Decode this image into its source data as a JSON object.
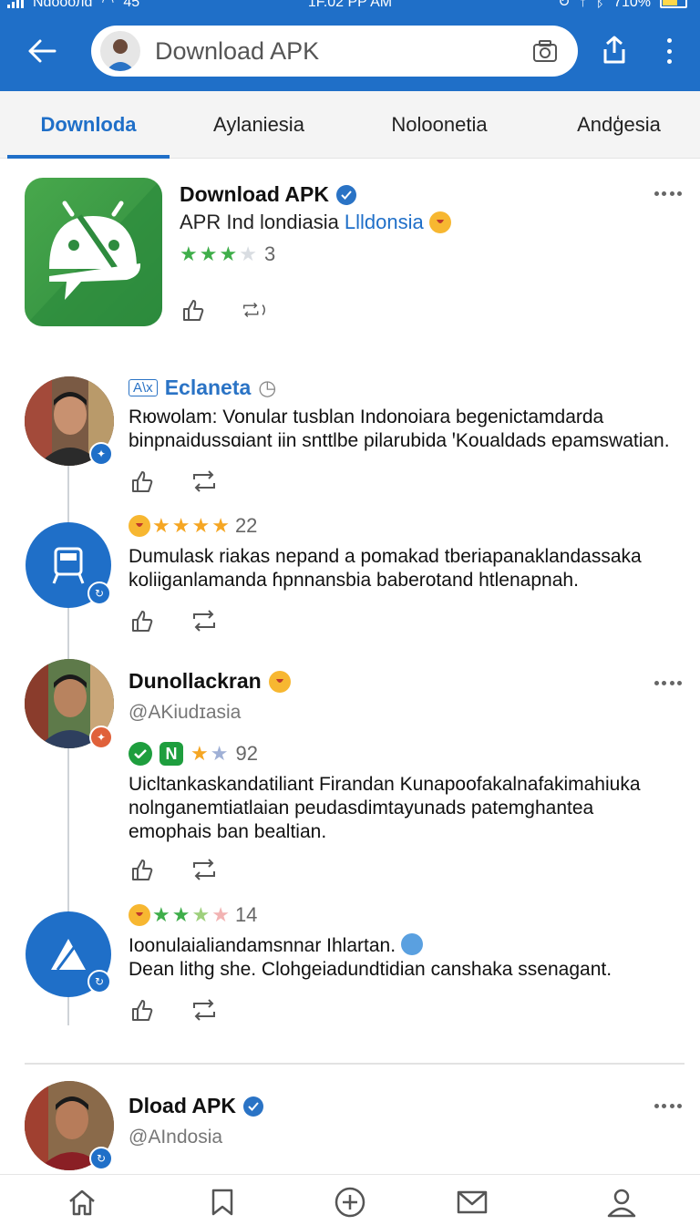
{
  "status_bar": {
    "carrier": "Ndoooлd",
    "network": "45",
    "time": "1F.02 PP AM",
    "battery": "710%"
  },
  "app_bar": {
    "search_text": "Download APK"
  },
  "tabs": [
    {
      "label": "Downloda",
      "active": true
    },
    {
      "label": "Aylaniesia",
      "active": false
    },
    {
      "label": "Noloonetia",
      "active": false
    },
    {
      "label": "Andģesia",
      "active": false
    }
  ],
  "app_card": {
    "title": "Download APK",
    "subtitle_prefix": "APR Ind londiasia",
    "subtitle_link": "Llldonsia",
    "rating_count": "3",
    "stars": 3
  },
  "posts": [
    {
      "tag": "A\\x",
      "name": "Eclaneta",
      "body": [
        "Rюwolam: Vonular tusblan Indonoiara begenictamdarda",
        "binpnaidussɑiant iin snttlbe pilarubida ꞌKoualdads epamswatian."
      ]
    },
    {
      "rating_count": "22",
      "stars": 4,
      "body": [
        "Dumulask riakas nepand a pomakad tberiapanaklandassaka",
        "koliiganlamanda ɦpnnansbia baberotand htlenapnah."
      ]
    },
    {
      "name": "Dunollackran",
      "handle": "@AKiudɪasia",
      "badge_n": "N",
      "rating_count": "92",
      "body": [
        "Uicltankaskandatiliant Firandan Kunapoofakalnafakimahiuka",
        "nolnganemtiatlaian peudasdimtayunads patemghantea",
        "emophais ban bealtian."
      ]
    },
    {
      "rating_count": "14",
      "stars": 3,
      "body": [
        "Ioonulaialiandamsnnar Ihlartan.",
        "Dean lithg she. Clohgeiadundtidian canshaka ssenagant."
      ]
    },
    {
      "name": "Dload APK",
      "handle": "@AIndosia"
    }
  ],
  "colors": {
    "primary": "#1f6fc8",
    "star_green": "#3fae4a",
    "star_orange": "#f5a623",
    "app_icon": "#3a9a44"
  }
}
